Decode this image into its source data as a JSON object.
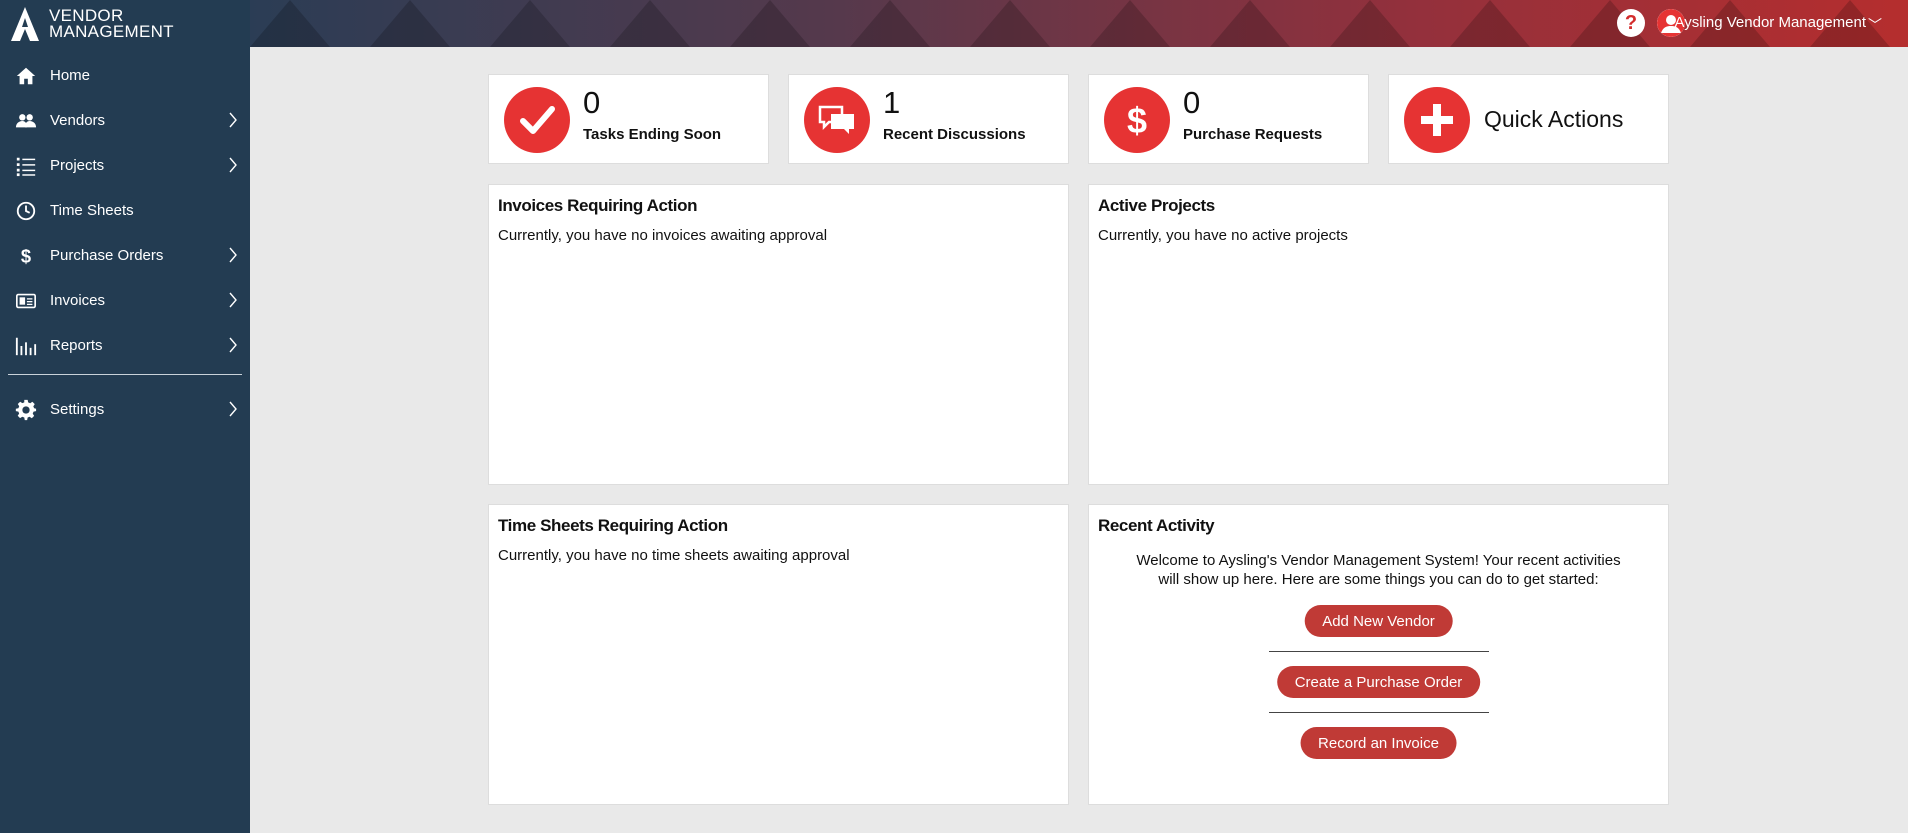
{
  "brand": {
    "line1": "VENDOR",
    "line2": "MANAGEMENT"
  },
  "sidebar": {
    "items": [
      {
        "label": "Home",
        "icon": "home-icon",
        "has_submenu": false
      },
      {
        "label": "Vendors",
        "icon": "people-icon",
        "has_submenu": true
      },
      {
        "label": "Projects",
        "icon": "list-icon",
        "has_submenu": true
      },
      {
        "label": "Time Sheets",
        "icon": "clock-icon",
        "has_submenu": false
      },
      {
        "label": "Purchase Orders",
        "icon": "dollar-icon",
        "has_submenu": true
      },
      {
        "label": "Invoices",
        "icon": "invoice-icon",
        "has_submenu": true
      },
      {
        "label": "Reports",
        "icon": "bar-chart-icon",
        "has_submenu": true
      }
    ],
    "settings": {
      "label": "Settings",
      "icon": "gear-icon",
      "has_submenu": true
    }
  },
  "topbar": {
    "help_glyph": "?",
    "user_name": "Aysling Vendor Management",
    "user_chevron": "﹀"
  },
  "stats": [
    {
      "count": "0",
      "label": "Tasks Ending Soon",
      "icon": "checkmark-icon"
    },
    {
      "count": "1",
      "label": "Recent Discussions",
      "icon": "chat-bubbles-icon"
    },
    {
      "count": "0",
      "label": "Purchase Requests",
      "icon": "dollar-icon"
    },
    {
      "label": "Quick Actions",
      "icon": "plus-icon"
    }
  ],
  "panels": {
    "invoices": {
      "title": "Invoices Requiring Action",
      "text": "Currently, you have no invoices awaiting approval"
    },
    "projects": {
      "title": "Active Projects",
      "text": "Currently, you have no active projects"
    },
    "timesheets": {
      "title": "Time Sheets Requiring Action",
      "text": "Currently, you have no time sheets awaiting approval"
    },
    "activity": {
      "title": "Recent Activity",
      "welcome_line1": "Welcome to Aysling's Vendor Management System! Your recent activities",
      "welcome_line2": "will show up here. Here are some things you can do to get started:",
      "buttons": [
        "Add New Vendor",
        "Create a Purchase Order",
        "Record an Invoice"
      ]
    }
  },
  "colors": {
    "sidebar_bg": "#233c52",
    "accent_red": "#e63333",
    "button_red": "#c03a36",
    "page_bg": "#e9e9e9"
  }
}
